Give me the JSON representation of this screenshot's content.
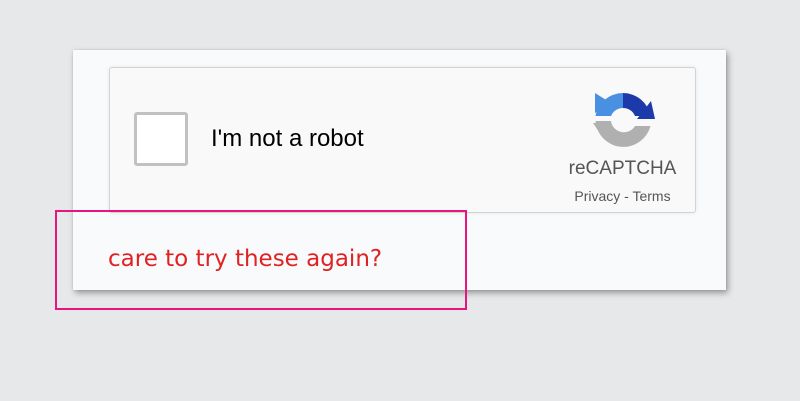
{
  "recaptcha": {
    "checkbox_label": "I'm not a robot",
    "brand": "reCAPTCHA",
    "privacy_link": "Privacy",
    "separator": " - ",
    "terms_link": "Terms",
    "logo_icon": "recaptcha-logo-icon",
    "checked": false
  },
  "error_message": "care to try these again?",
  "colors": {
    "page_background": "#e7e8ea",
    "error_text": "#e02222",
    "highlight_border": "#e8157e",
    "logo_blue": "#1c3aa9",
    "logo_light_blue": "#4a90e2",
    "logo_gray": "#b0b0b0"
  }
}
